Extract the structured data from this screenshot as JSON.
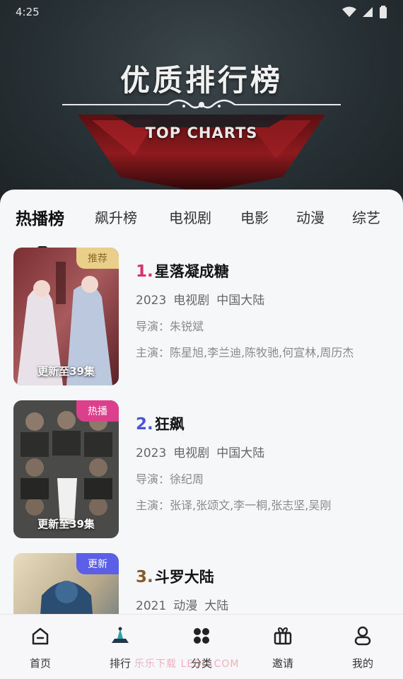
{
  "status_bar": {
    "time": "4:25"
  },
  "banner": {
    "title": "优质排行榜",
    "subtitle": "TOP CHARTS"
  },
  "tabs": [
    "热播榜",
    "飙升榜",
    "电视剧",
    "电影",
    "动漫",
    "综艺"
  ],
  "active_tab_index": 0,
  "items": [
    {
      "rank": "1.",
      "title": "星落凝成糖",
      "rank_color": "#d6336c",
      "badge": "推荐",
      "badge_color": "#e9cf8a",
      "year": "2023",
      "category": "电视剧",
      "region": "中国大陆",
      "director": "导演：朱锐斌",
      "cast": "主演：陈星旭,李兰迪,陈牧驰,何宣林,周历杰",
      "poster_caption": "更新至39集"
    },
    {
      "rank": "2.",
      "title": "狂飙",
      "rank_color": "#4b56d6",
      "badge": "热播",
      "badge_color": "#dc3f8c",
      "year": "2023",
      "category": "电视剧",
      "region": "中国大陆",
      "director": "导演：徐纪周",
      "cast": "主演：张译,张颂文,李一桐,张志坚,吴刚",
      "poster_caption": "更新至39集"
    },
    {
      "rank": "3.",
      "title": "斗罗大陆",
      "rank_color": "#8a5a2b",
      "badge": "更新",
      "badge_color": "#5b5ee6",
      "year": "2021",
      "category": "动漫",
      "region": "大陆",
      "director": "",
      "cast": "",
      "poster_caption": ""
    }
  ],
  "bottom_nav": [
    {
      "label": "首页",
      "icon": "home-icon"
    },
    {
      "label": "排行",
      "icon": "ranking-icon"
    },
    {
      "label": "分类",
      "icon": "category-icon"
    },
    {
      "label": "邀请",
      "icon": "gift-icon"
    },
    {
      "label": "我的",
      "icon": "profile-icon"
    }
  ],
  "watermark": "乐乐下载 LEDU.COM"
}
